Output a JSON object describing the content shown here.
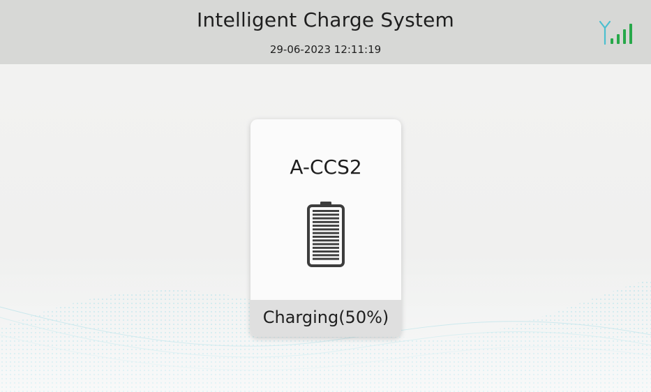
{
  "header": {
    "title": "Intelligent Charge System",
    "datetime": "29-06-2023 12:11:19"
  },
  "status_icons": {
    "signal_icon": "signal-strength-icon",
    "signal_color": "#27a84a",
    "antenna_color": "#4bbfcf"
  },
  "connector": {
    "name": "A-CCS2",
    "status": "Charging(50%)",
    "charge_level": 0.5,
    "icon": "battery-icon"
  }
}
